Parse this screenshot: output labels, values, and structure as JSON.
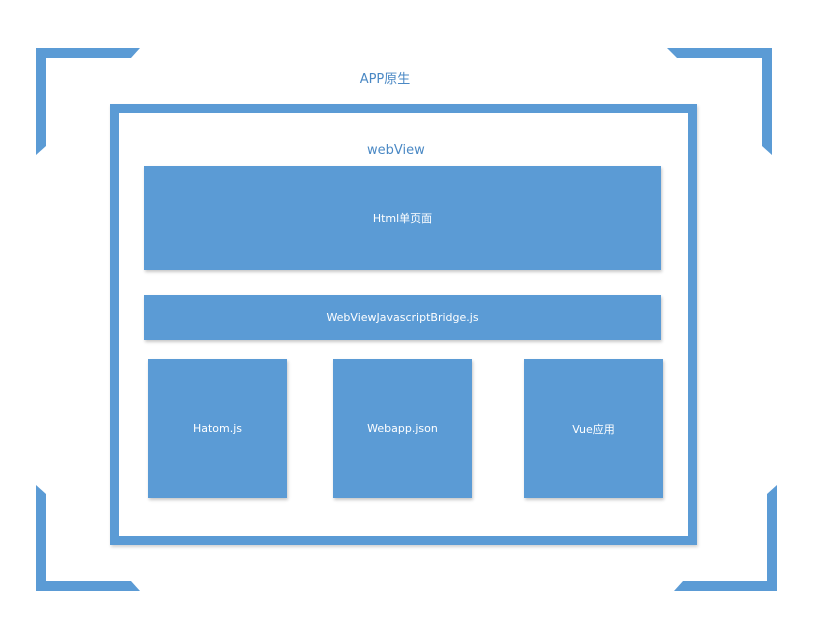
{
  "diagram": {
    "app_label": "APP原生",
    "webview_label": "webView",
    "html_page_label": "Html单页面",
    "bridge_label": "WebViewJavascriptBridge.js",
    "modules": [
      {
        "label": "Hatom.js"
      },
      {
        "label": "Webapp.json"
      },
      {
        "label": "Vue应用"
      }
    ],
    "accent_color": "#5b9bd5"
  }
}
